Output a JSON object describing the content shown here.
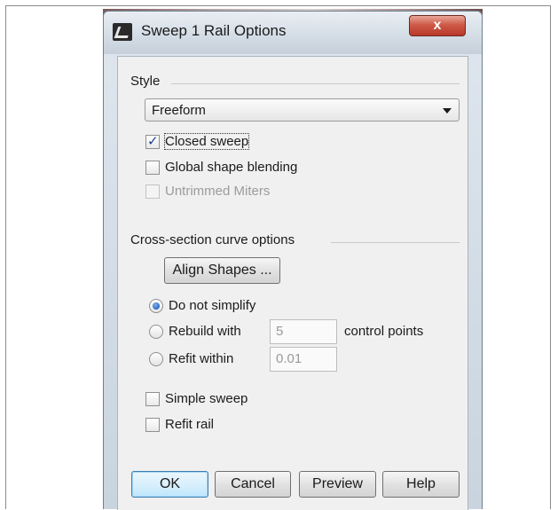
{
  "window": {
    "title": "Sweep 1 Rail Options",
    "close_glyph": "x"
  },
  "style_group": {
    "label": "Style",
    "dropdown_value": "Freeform",
    "options": [
      {
        "label": "Closed sweep",
        "checked": true,
        "enabled": true
      },
      {
        "label": "Global shape blending",
        "checked": false,
        "enabled": true
      },
      {
        "label": "Untrimmed Miters",
        "checked": false,
        "enabled": false
      }
    ]
  },
  "cross_section": {
    "label": "Cross-section curve options",
    "align_button": "Align Shapes ...",
    "radios": [
      {
        "label": "Do not simplify",
        "selected": true
      },
      {
        "label": "Rebuild with",
        "selected": false,
        "value": "5",
        "suffix": "control points"
      },
      {
        "label": "Refit within",
        "selected": false,
        "value": "0.01"
      }
    ]
  },
  "extra_options": [
    {
      "label": "Simple sweep",
      "checked": false
    },
    {
      "label": "Refit rail",
      "checked": false
    }
  ],
  "buttons": {
    "ok": "OK",
    "cancel": "Cancel",
    "preview": "Preview",
    "help": "Help"
  },
  "icons": [
    "app-icon",
    "close-icon",
    "chevron-down-icon",
    "check-icon"
  ],
  "colors": {
    "accent": "#2a67c4",
    "close": "#c8402f",
    "window_bg": "#f0f0f0"
  }
}
